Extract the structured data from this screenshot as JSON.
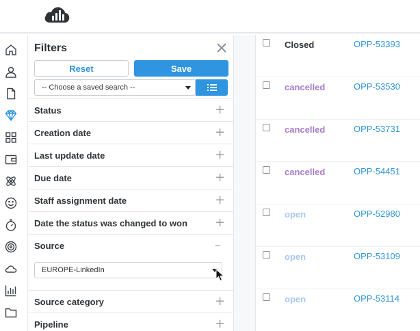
{
  "header": {
    "logo": "cloud-chart-logo"
  },
  "rail": {
    "icons": [
      "home-icon",
      "user-icon",
      "document-icon",
      "diamond-icon",
      "grid-icon",
      "wallet-icon",
      "atom-icon",
      "smiley-icon",
      "stopwatch-icon",
      "target-icon",
      "cloud-icon",
      "bar-chart-icon",
      "folder-icon"
    ],
    "active_color": "#2f95e0"
  },
  "filters": {
    "title": "Filters",
    "reset_label": "Reset",
    "save_label": "Save",
    "saved_search_value": "-- Choose a saved search --",
    "rows": [
      {
        "label": "Status",
        "toggle": "+"
      },
      {
        "label": "Creation date",
        "toggle": "+"
      },
      {
        "label": "Last update date",
        "toggle": "+"
      },
      {
        "label": "Due date",
        "toggle": "+"
      },
      {
        "label": "Staff assignment date",
        "toggle": "+"
      },
      {
        "label": "Date the status was changed to won",
        "toggle": "+"
      },
      {
        "label": "Source",
        "toggle": "–"
      },
      {
        "label": "Source category",
        "toggle": "+"
      },
      {
        "label": "Pipeline",
        "toggle": "+"
      }
    ],
    "source_value": "EUROPE-LinkedIn"
  },
  "opportunities": {
    "rows": [
      {
        "status": "Closed",
        "id": "OPP-53393",
        "status_color": "#2f3438"
      },
      {
        "status": "cancelled",
        "id": "OPP-53530",
        "status_color": "#a77cc9"
      },
      {
        "status": "cancelled",
        "id": "OPP-53731",
        "status_color": "#a77cc9"
      },
      {
        "status": "cancelled",
        "id": "OPP-54451",
        "status_color": "#a77cc9"
      },
      {
        "status": "open",
        "id": "OPP-52980",
        "status_color": "#a9c8ee"
      },
      {
        "status": "open",
        "id": "OPP-53109",
        "status_color": "#a9c8ee"
      },
      {
        "status": "open",
        "id": "OPP-53114",
        "status_color": "#a9c8ee"
      }
    ]
  }
}
